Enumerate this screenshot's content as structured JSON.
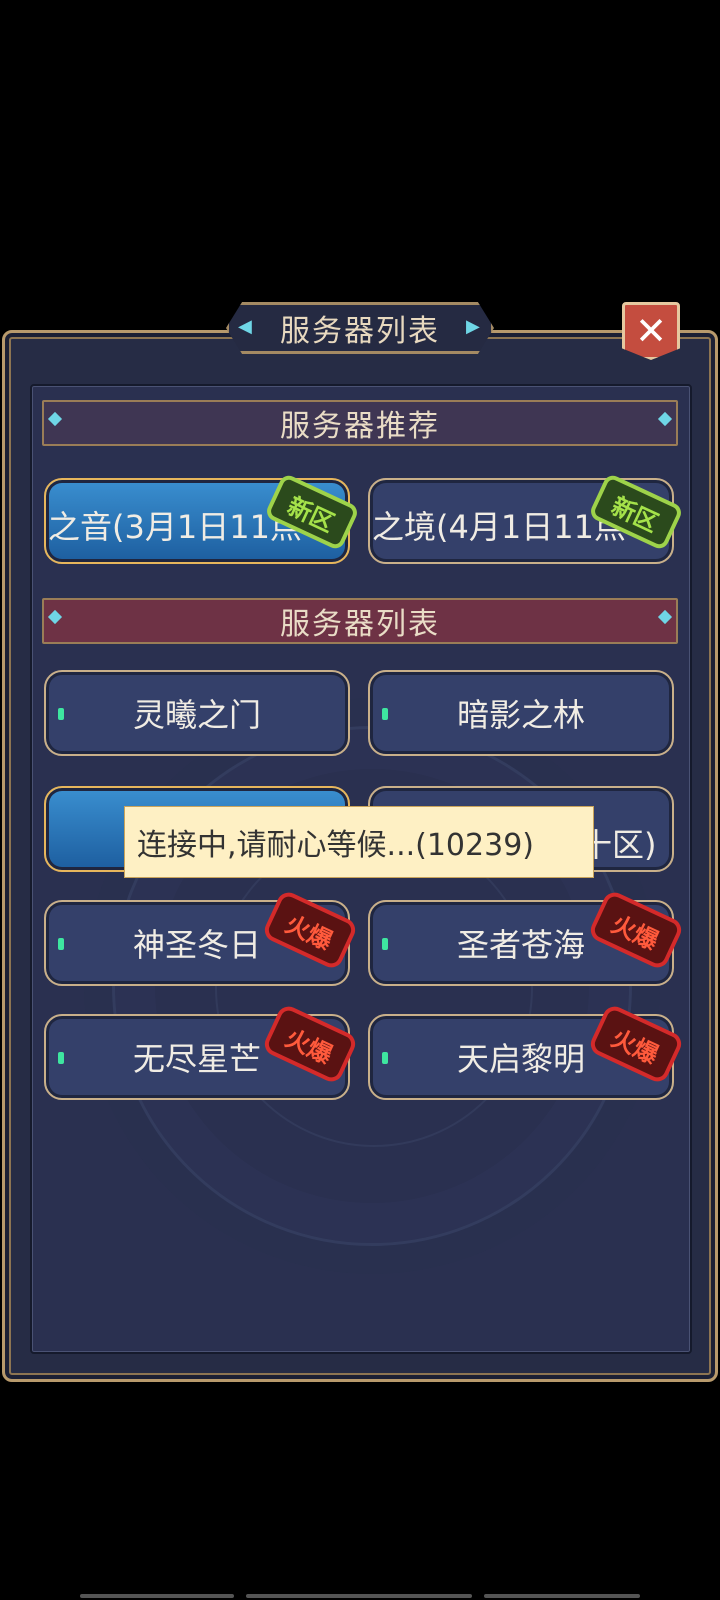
{
  "window": {
    "title": "服务器列表"
  },
  "sections": {
    "recommend_title": "服务器推荐",
    "list_title": "服务器列表"
  },
  "recommended": [
    {
      "name": "之音(3月1日11点",
      "badge": "新区",
      "selected": true
    },
    {
      "name": "之境(4月1日11点",
      "badge": "新区",
      "selected": false
    }
  ],
  "servers": [
    {
      "name": "灵曦之门",
      "badge": ""
    },
    {
      "name": "暗影之林",
      "badge": ""
    },
    {
      "name": "",
      "badge": ""
    },
    {
      "name": "",
      "badge": ""
    },
    {
      "name": "神圣冬日",
      "badge": "火爆"
    },
    {
      "name": "圣者苍海",
      "badge": "火爆"
    },
    {
      "name": "无尽星芒",
      "badge": "火爆"
    },
    {
      "name": "天启黎明",
      "badge": "火爆"
    }
  ],
  "tooltip": {
    "text": "连接中,请耐心等候...(10239)"
  },
  "partial_label": "十区)",
  "close": {
    "icon": "close-icon",
    "label": "✕"
  },
  "colors": {
    "accent": "#c9b08a",
    "selected": "#2e7fc0",
    "new_badge": "#9ed34a",
    "hot_badge": "#d42a2a"
  }
}
